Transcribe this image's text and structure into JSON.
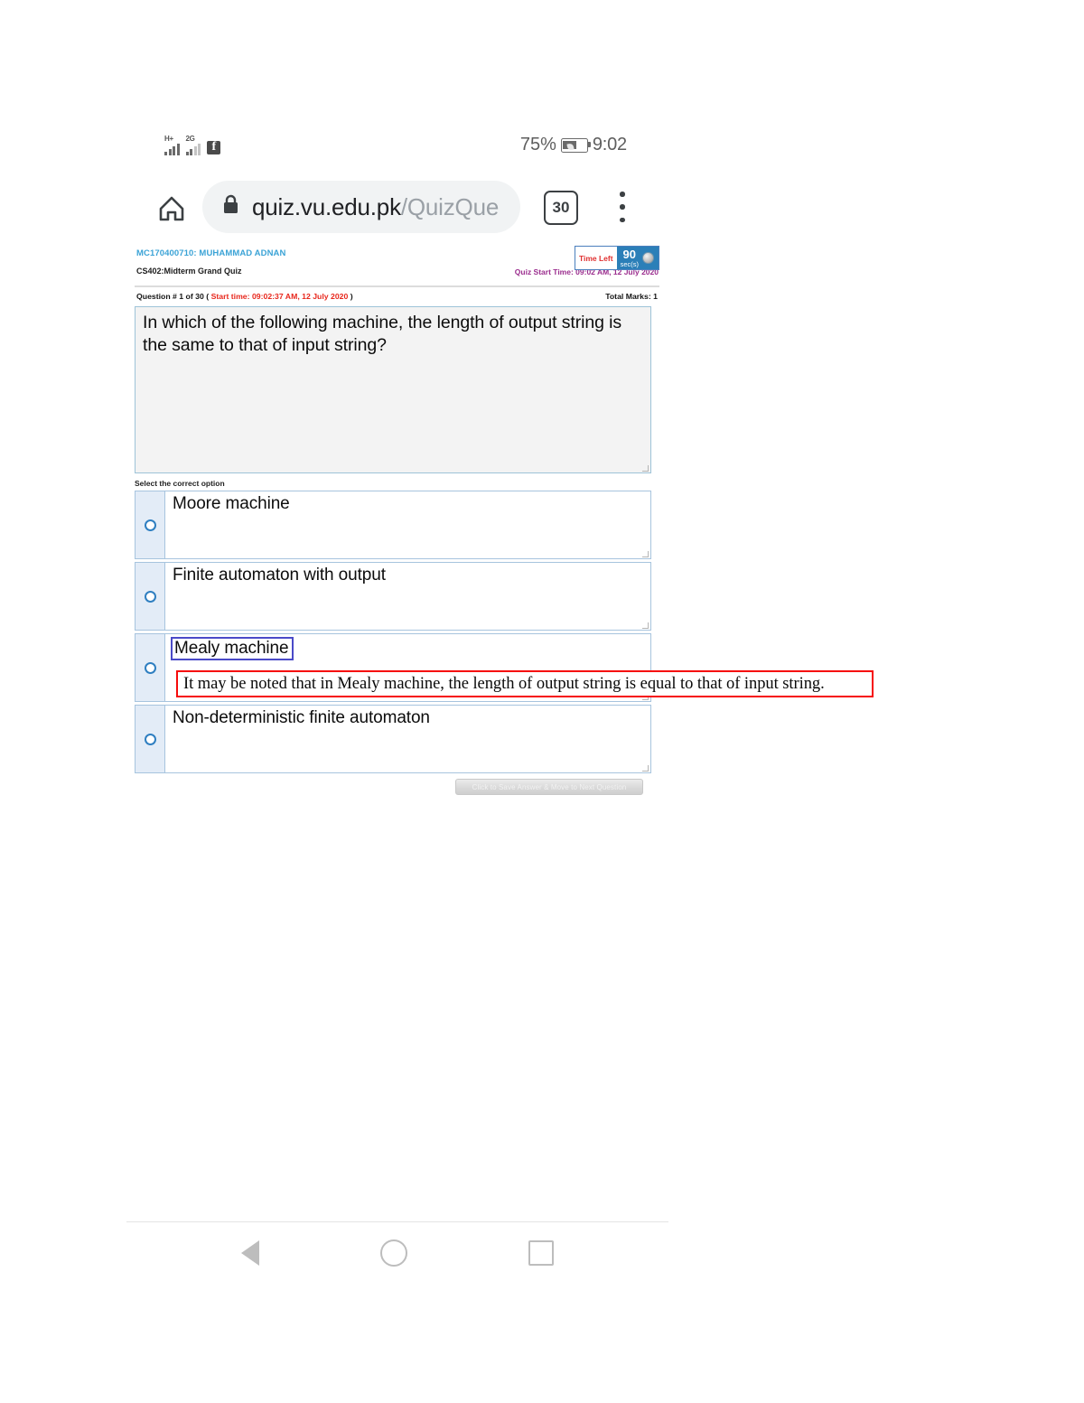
{
  "status_bar": {
    "signal_1_label": "H+",
    "signal_2_label": "2G",
    "app_icon": "facebook-icon",
    "battery_percent": "75%",
    "clock": "9:02"
  },
  "browser": {
    "home_icon": "home-icon",
    "lock_icon": "lock-icon",
    "url_domain": "quiz.vu.edu.pk",
    "url_path": "/QuizQue",
    "tab_count": "30",
    "menu_icon": "overflow-menu-icon"
  },
  "quiz": {
    "student_id_name": "MC170400710: MUHAMMAD ADNAN",
    "course": "CS402:Midterm Grand Quiz",
    "quiz_start_time": "Quiz Start Time: 09:02 AM, 12 July 2020",
    "timer": {
      "label": "Time Left",
      "seconds": "90",
      "unit": "sec(s)"
    },
    "question_meta": {
      "prefix": "Question # 1 of 30 ( ",
      "start_time": "Start time: 09:02:37 AM, 12 July 2020",
      "suffix": " )",
      "total_marks": "Total Marks: 1"
    },
    "question_text": "In which of the following machine, the length of output string is the same to that of input string?",
    "select_label": "Select the correct option",
    "options": [
      {
        "label": "Moore machine",
        "selected": false,
        "boxed": false
      },
      {
        "label": "Finite automaton with output",
        "selected": false,
        "boxed": false
      },
      {
        "label": "Mealy machine",
        "selected": false,
        "boxed": true
      },
      {
        "label": "Non-deterministic finite automaton",
        "selected": false,
        "boxed": false
      }
    ],
    "save_button_label": "Click to Save Answer & Move to Next Question",
    "annotation": "It may be noted that in Mealy machine, the length of output string is equal to that of input string."
  },
  "nav_bar": {
    "back_icon": "back-triangle-icon",
    "home_icon": "home-circle-icon",
    "recents_icon": "recents-square-icon"
  },
  "colors": {
    "accent_blue": "#2b7fb8",
    "student_blue": "#3ba3d6",
    "start_time_red": "#e8271c",
    "quiz_time_purple": "#9b2d8e",
    "annotation_red": "#f60b0b",
    "option_border": "#a7c4de",
    "highlight_box": "#4a4ac8"
  }
}
